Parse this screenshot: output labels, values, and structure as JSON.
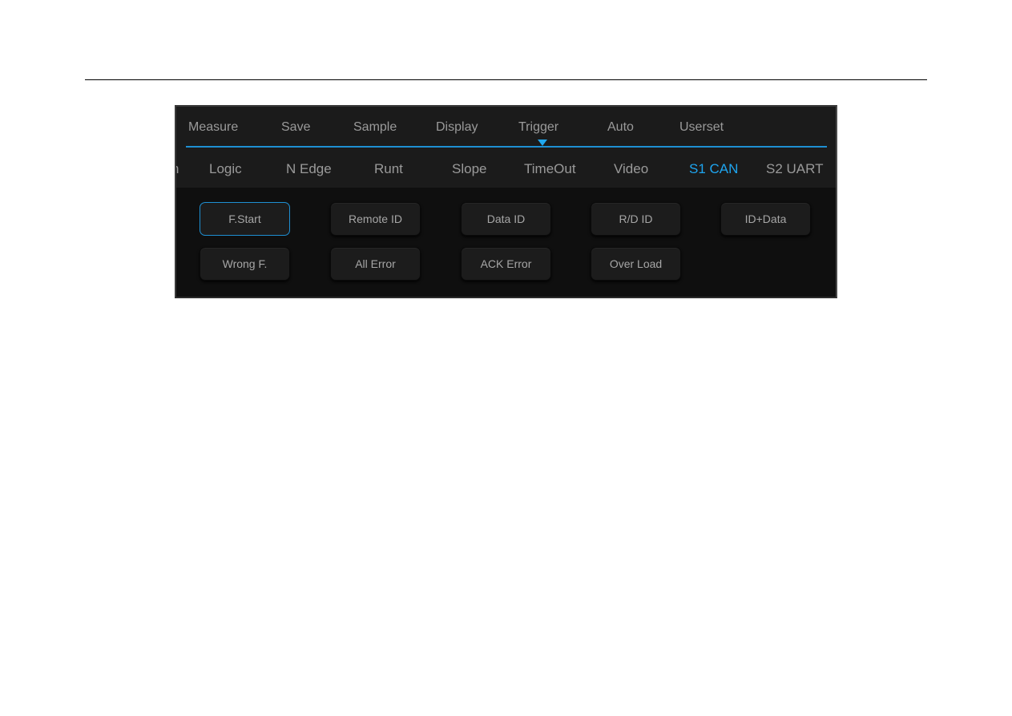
{
  "top_menu": {
    "items": [
      {
        "label": "Measure"
      },
      {
        "label": "Save"
      },
      {
        "label": "Sample"
      },
      {
        "label": "Display"
      },
      {
        "label": "Trigger",
        "active": true
      },
      {
        "label": "Auto"
      },
      {
        "label": "Userset"
      }
    ],
    "accent_color": "#1ea5f0"
  },
  "sub_menu": {
    "items": [
      {
        "label": "n"
      },
      {
        "label": "Logic"
      },
      {
        "label": "N Edge"
      },
      {
        "label": "Runt"
      },
      {
        "label": "Slope"
      },
      {
        "label": "TimeOut"
      },
      {
        "label": "Video"
      },
      {
        "label": "S1 CAN",
        "active": true
      },
      {
        "label": "S2 UART"
      }
    ]
  },
  "can_trigger_buttons": [
    {
      "label": "F.Start",
      "selected": true
    },
    {
      "label": "Remote ID"
    },
    {
      "label": "Data ID"
    },
    {
      "label": "R/D ID"
    },
    {
      "label": "ID+Data"
    },
    {
      "label": "Wrong F."
    },
    {
      "label": "All Error"
    },
    {
      "label": "ACK Error"
    },
    {
      "label": "Over Load"
    }
  ]
}
